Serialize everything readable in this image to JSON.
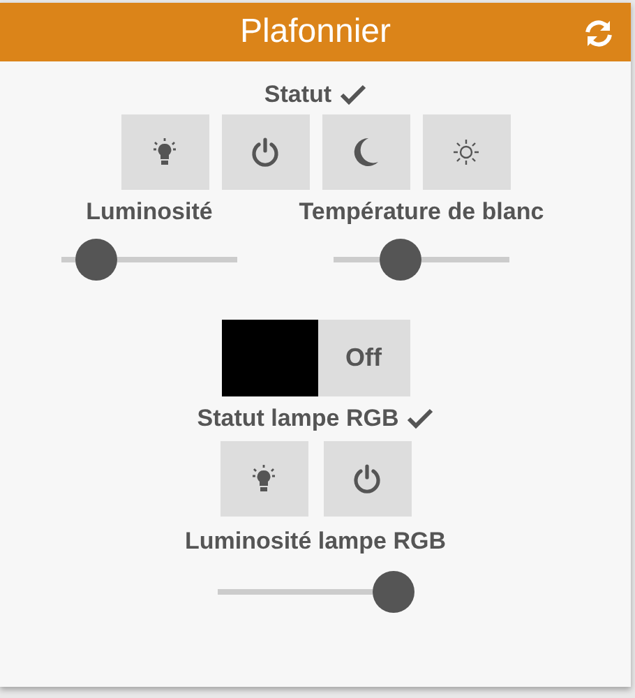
{
  "widget": {
    "title": "Plafonnier"
  },
  "status": {
    "label": "Statut",
    "ok": true
  },
  "status_buttons": [
    {
      "kind": "bulb"
    },
    {
      "kind": "power"
    },
    {
      "kind": "moon"
    },
    {
      "kind": "sun"
    }
  ],
  "sliders": [
    {
      "label": "Luminosité",
      "level": 0.2
    },
    {
      "label": "Température de blanc",
      "level": 0.38
    }
  ],
  "rgb": {
    "color": "#000000",
    "state": "Off"
  },
  "rgb_status": {
    "label": "Statut lampe RGB",
    "ok": true
  },
  "rgb_buttons": [
    {
      "kind": "bulb"
    },
    {
      "kind": "power"
    }
  ],
  "rgb_slider": {
    "label": "Luminosité lampe RGB",
    "level": 0.9
  }
}
